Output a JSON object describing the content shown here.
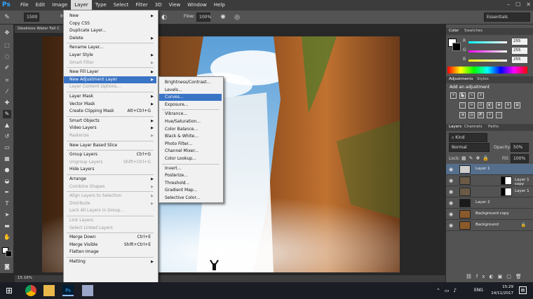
{
  "app": {
    "logo": "Ps"
  },
  "menubar": {
    "items": [
      "File",
      "Edit",
      "Image",
      "Layer",
      "Type",
      "Select",
      "Filter",
      "3D",
      "View",
      "Window",
      "Help"
    ],
    "active": "Layer"
  },
  "window_controls": {
    "minimize": "–",
    "maximize": "☐",
    "close": "✕"
  },
  "options": {
    "brush_size": "1500",
    "mode_label": "M",
    "flow_label": "Flow:",
    "flow_value": "100%",
    "workspace": "Essentials"
  },
  "document": {
    "tab_title": "Sleekless Water Fall C",
    "zoom": "15.16%"
  },
  "layer_menu": {
    "items": [
      {
        "label": "New",
        "arrow": true
      },
      {
        "label": "Copy CSS"
      },
      {
        "label": "Duplicate Layer..."
      },
      {
        "label": "Delete",
        "arrow": true
      },
      {
        "label": "Rename Layer..."
      },
      {
        "label": "Layer Style",
        "arrow": true
      },
      {
        "label": "Smart Filter",
        "arrow": true,
        "disabled": true
      },
      {
        "label": "New Fill Layer",
        "arrow": true
      },
      {
        "label": "New Adjustment Layer",
        "arrow": true,
        "highlight": true
      },
      {
        "label": "Layer Content Options...",
        "disabled": true
      },
      {
        "label": "Layer Mask",
        "arrow": true
      },
      {
        "label": "Vector Mask",
        "arrow": true
      },
      {
        "label": "Create Clipping Mask",
        "shortcut": "Alt+Ctrl+G"
      },
      {
        "label": "Smart Objects",
        "arrow": true
      },
      {
        "label": "Video Layers",
        "arrow": true
      },
      {
        "label": "Rasterize",
        "arrow": true,
        "disabled": true
      },
      {
        "label": "New Layer Based Slice"
      },
      {
        "label": "Group Layers",
        "shortcut": "Ctrl+G"
      },
      {
        "label": "Ungroup Layers",
        "shortcut": "Shift+Ctrl+G",
        "disabled": true
      },
      {
        "label": "Hide Layers"
      },
      {
        "label": "Arrange",
        "arrow": true
      },
      {
        "label": "Combine Shapes",
        "arrow": true,
        "disabled": true
      },
      {
        "label": "Align Layers to Selection",
        "arrow": true,
        "disabled": true
      },
      {
        "label": "Distribute",
        "arrow": true,
        "disabled": true
      },
      {
        "label": "Lock All Layers in Group...",
        "disabled": true
      },
      {
        "label": "Link Layers",
        "disabled": true
      },
      {
        "label": "Select Linked Layers",
        "disabled": true
      },
      {
        "label": "Merge Down",
        "shortcut": "Ctrl+E"
      },
      {
        "label": "Merge Visible",
        "shortcut": "Shift+Ctrl+E"
      },
      {
        "label": "Flatten Image"
      },
      {
        "label": "Matting",
        "arrow": true
      }
    ]
  },
  "adjustment_submenu": {
    "items": [
      {
        "label": "Brightness/Contrast..."
      },
      {
        "label": "Levels..."
      },
      {
        "label": "Curves...",
        "highlight": true
      },
      {
        "label": "Exposure..."
      },
      {
        "label": "Vibrance..."
      },
      {
        "label": "Hue/Saturation..."
      },
      {
        "label": "Color Balance..."
      },
      {
        "label": "Black & White..."
      },
      {
        "label": "Photo Filter..."
      },
      {
        "label": "Channel Mixer..."
      },
      {
        "label": "Color Lookup..."
      },
      {
        "label": "Invert..."
      },
      {
        "label": "Posterize..."
      },
      {
        "label": "Threshold..."
      },
      {
        "label": "Gradient Map..."
      },
      {
        "label": "Selective Color..."
      }
    ]
  },
  "color_panel": {
    "tabs": [
      "Color",
      "Swatches"
    ],
    "channels": [
      {
        "label": "R",
        "value": "255",
        "fraction": 1.0
      },
      {
        "label": "G",
        "value": "255",
        "fraction": 1.0
      },
      {
        "label": "B",
        "value": "255",
        "fraction": 1.0
      }
    ]
  },
  "adjustments_panel": {
    "tabs": [
      "Adjustments",
      "Styles"
    ],
    "heading": "Add an adjustment"
  },
  "layers_panel": {
    "tabs": [
      "Layers",
      "Channels",
      "Paths"
    ],
    "kind_label": "Kind",
    "blend_mode": "Normal",
    "opacity_label": "Opacity:",
    "opacity_value": "50%",
    "lock_label": "Lock:",
    "fill_label": "Fill:",
    "fill_value": "100%",
    "layers": [
      {
        "name": "Layer 1",
        "selected": true
      },
      {
        "name": "Layer 1 copy"
      },
      {
        "name": "Layer 1"
      },
      {
        "name": "Layer 2"
      },
      {
        "name": "Background copy"
      },
      {
        "name": "Background",
        "locked": true
      }
    ]
  },
  "taskbar": {
    "language": "ENG",
    "time": "15:29",
    "date": "14/11/2017"
  },
  "colors": {
    "menu_highlight": "#3a74c5",
    "layer_selected": "#556e8c",
    "ps_blue": "#31a8ff"
  }
}
